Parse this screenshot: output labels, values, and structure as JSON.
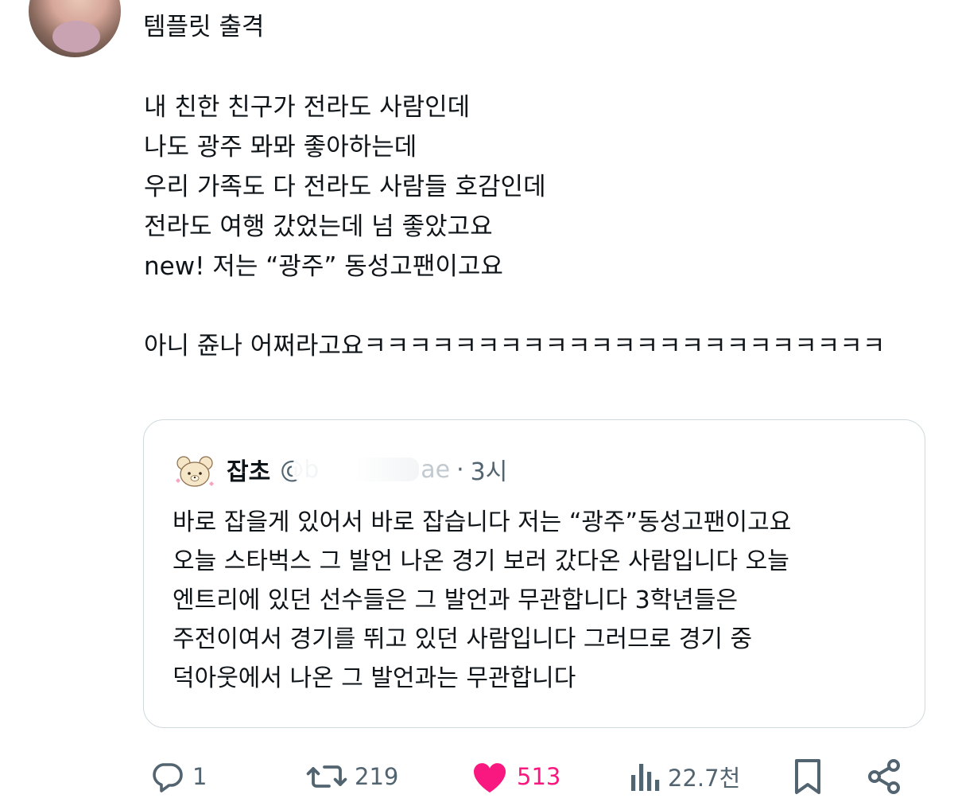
{
  "post": {
    "author_name": "템플릿 출격",
    "text": "내 친한 친구가 전라도 사람인데\n나도 광주 뫄뫄 좋아하는데\n우리 가족도 다 전라도 사람들 호감인데\n전라도 여행 갔었는데 넘 좋았고요\nnew! 저는 “광주” 동성고팬이고요\n\n아니 쥰나 어쩌라고요ㅋㅋㅋㅋㅋㅋㅋㅋㅋㅋㅋㅋㅋㅋㅋㅋㅋㅋㅋㅋㅋㅋㅋ"
  },
  "quote": {
    "author_name": "잡초",
    "handle_start": "@b",
    "handle_end": "ae",
    "separator": "·",
    "time": "3시",
    "text": "바로 잡을게 있어서 바로 잡습니다 저는 “광주”동성고팬이고요\n오늘 스타벅스 그 발언 나온 경기 보러 갔다온 사람입니다 오늘\n엔트리에 있던 선수들은 그 발언과 무관합니다 3학년들은\n주전이여서 경기를 뛰고 있던 사람입니다 그러므로 경기 중\n덕아웃에서 나온 그 발언과는 무관합니다"
  },
  "actions": {
    "reply": {
      "icon": "reply-icon",
      "count": "1"
    },
    "repost": {
      "icon": "repost-icon",
      "count": "219"
    },
    "like": {
      "icon": "heart-icon",
      "count": "513",
      "active": true,
      "color": "#f91880"
    },
    "views": {
      "icon": "views-icon",
      "count": "22.7천"
    },
    "bookmark": {
      "icon": "bookmark-icon"
    },
    "share": {
      "icon": "share-icon"
    }
  },
  "colors": {
    "text": "#0f1419",
    "secondary": "#536471",
    "border": "#cfd9de",
    "like": "#f91880"
  }
}
